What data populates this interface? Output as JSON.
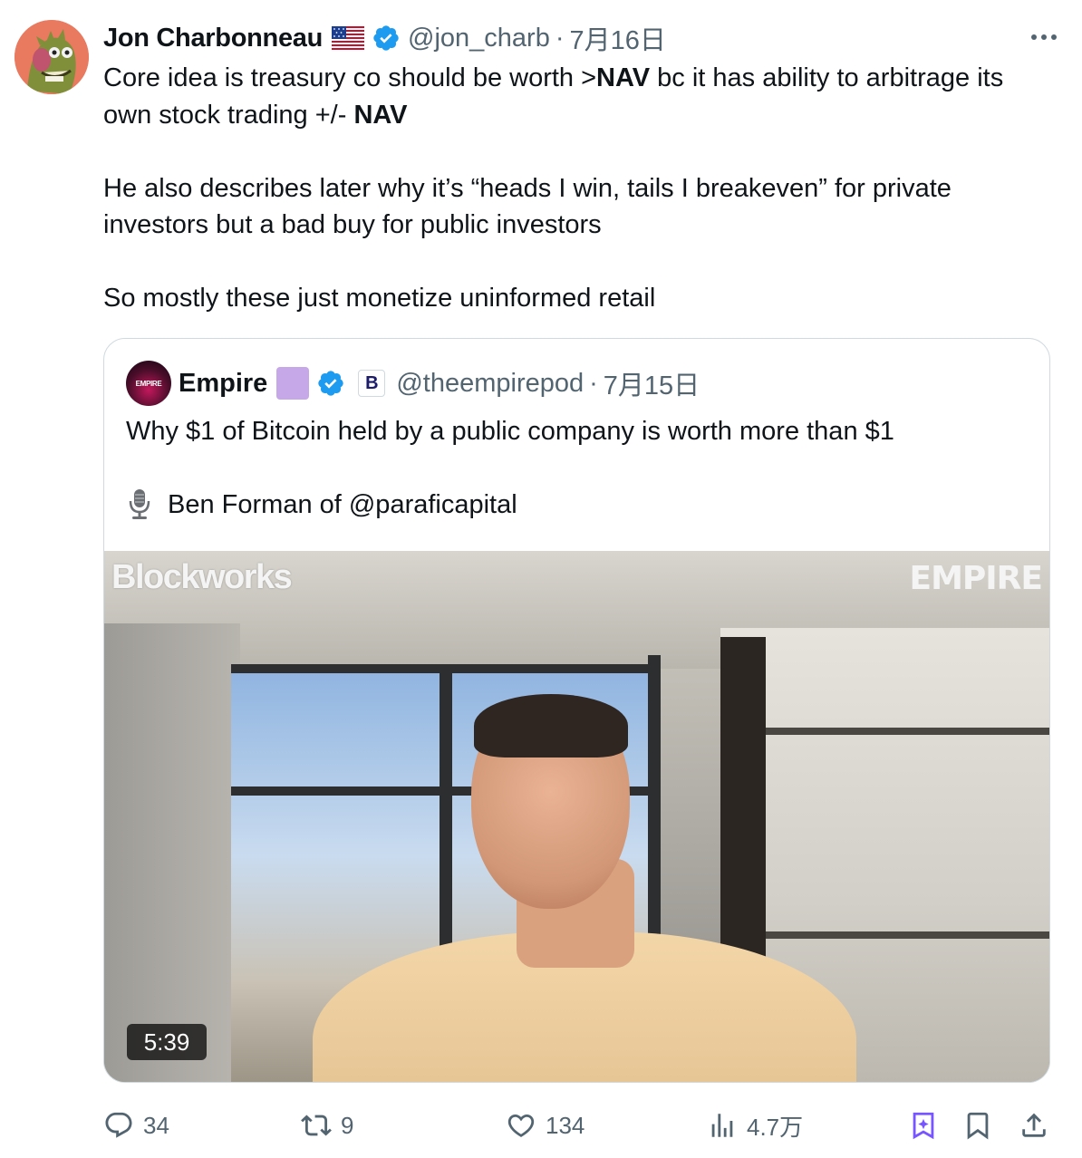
{
  "tweet": {
    "author_name": "Jon Charbonneau",
    "handle": "@jon_charb",
    "separator": "·",
    "date": "7月16日",
    "body": {
      "p1_pre": "Core idea is treasury co should be worth >",
      "p1_bold1": "NAV",
      "p1_mid": " bc it has ability to arbitrage its own stock trading +/- ",
      "p1_bold2": "NAV",
      "p2": "He also describes later why it’s “heads I win, tails I breakeven” for private investors but a bad buy for public investors",
      "p3": "So mostly these just monetize uninformed retail"
    }
  },
  "quote": {
    "avatar_text": "EMPIRE",
    "author_name": "Empire",
    "handle": "@theempirepod",
    "separator": "·",
    "date": "7月15日",
    "affiliate_letter": "B",
    "line1": "Why $1 of Bitcoin held by a public company is worth more than $1",
    "line2": "Ben Forman of @paraficapital",
    "video": {
      "logo_left": "Blockworks",
      "logo_right": "EMPIRE",
      "duration": "5:39"
    }
  },
  "actions": {
    "replies": "34",
    "reposts": "9",
    "likes": "134",
    "views": "4.7万"
  },
  "colors": {
    "text_primary": "#0f1419",
    "text_secondary": "#536471",
    "verified_blue": "#1d9bf0",
    "grok_purple": "#7856ff",
    "border": "#cfd9de"
  }
}
